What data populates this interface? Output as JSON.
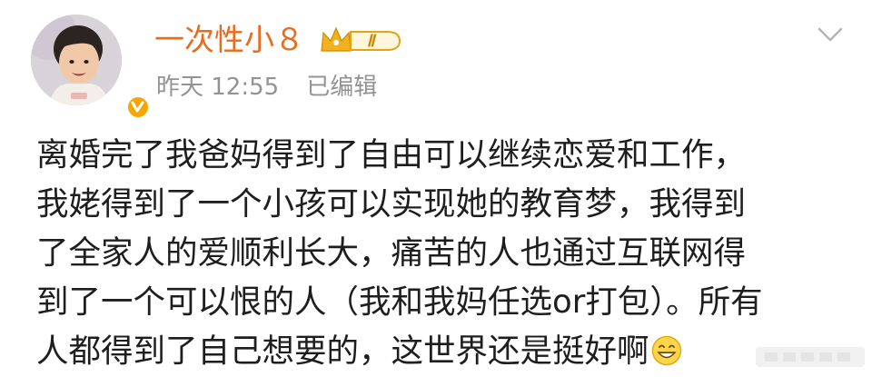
{
  "post": {
    "author": {
      "name": "一次性小８",
      "vip_level": "Ⅱ"
    },
    "meta": {
      "time": "昨天 12:55",
      "edited": "已编辑"
    },
    "content_lines": [
      "离婚完了我爸妈得到了自由可以继续恋爱和工作，",
      "我姥得到了一个小孩可以实现她的教育梦，我得到",
      "了全家人的爱顺利长大，痛苦的人也通过互联网得",
      "到了一个可以恨的人（我和我妈任选or打包）。所有",
      "人都得到了自己想要的，这世界还是挺好啊"
    ],
    "icons": {
      "vip": "crown-vip-icon",
      "verified": "verified-v-icon",
      "menu": "chevron-down-icon",
      "emoji": "grin-emoji-icon"
    },
    "colors": {
      "name": "#ea6b1c",
      "meta": "#939393",
      "text": "#1e1e1e",
      "verified": "#f7a600",
      "vip_gold": "#e0a31a"
    }
  }
}
